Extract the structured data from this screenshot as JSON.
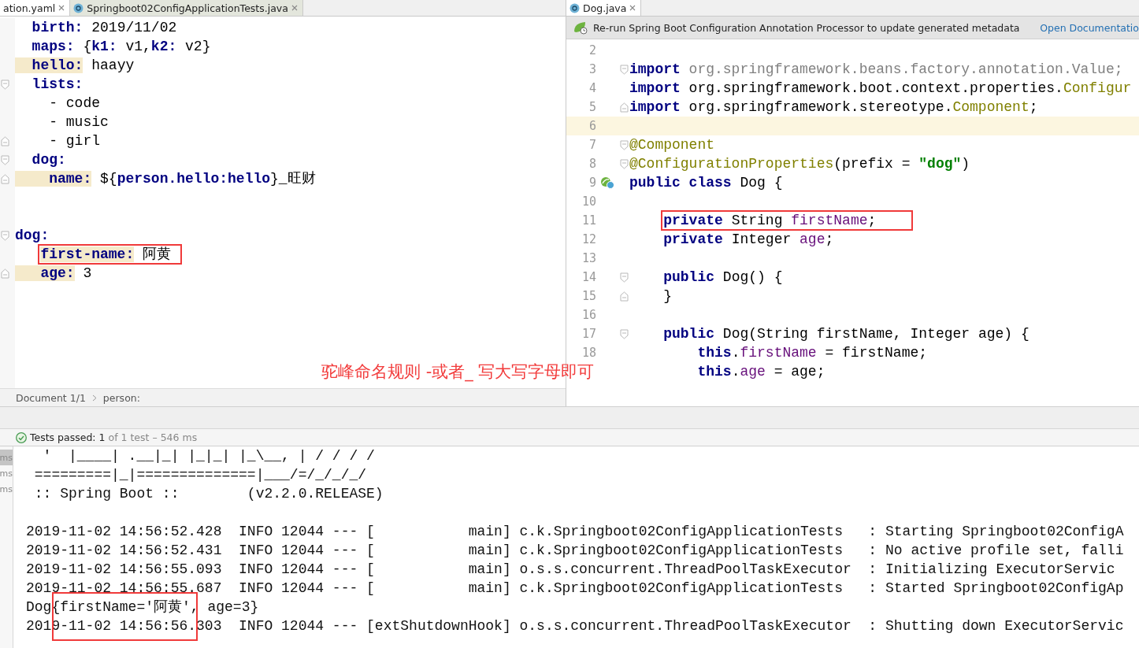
{
  "left_pane": {
    "tabs": [
      {
        "label": "ation.yaml",
        "selected": true,
        "kind": "yaml"
      },
      {
        "label": "Springboot02ConfigApplicationTests.java",
        "selected": false,
        "kind": "java"
      }
    ],
    "lines": [
      {
        "kind": "code",
        "tokens": [
          {
            "kind": "key",
            "text": "  birth:"
          },
          {
            "kind": "plain",
            "text": " 2019/11/02"
          }
        ]
      },
      {
        "kind": "code",
        "tokens": [
          {
            "kind": "key",
            "text": "  maps:"
          },
          {
            "kind": "plain",
            "text": " {"
          },
          {
            "kind": "key",
            "text": "k1:"
          },
          {
            "kind": "plain",
            "text": " v1,"
          },
          {
            "kind": "key",
            "text": "k2:"
          },
          {
            "kind": "plain",
            "text": " v2}"
          }
        ]
      },
      {
        "kind": "code",
        "tokens": [
          {
            "kind": "key_hl",
            "text": "  hello:"
          },
          {
            "kind": "plain",
            "text": " haayy"
          }
        ]
      },
      {
        "kind": "code",
        "fold_start": true,
        "tokens": [
          {
            "kind": "key",
            "text": "  lists:"
          }
        ]
      },
      {
        "kind": "code",
        "tokens": [
          {
            "kind": "plain",
            "text": "    - code"
          }
        ]
      },
      {
        "kind": "code",
        "tokens": [
          {
            "kind": "plain",
            "text": "    - music"
          }
        ]
      },
      {
        "kind": "code",
        "fold_end": true,
        "tokens": [
          {
            "kind": "plain",
            "text": "    - girl"
          }
        ]
      },
      {
        "kind": "code",
        "fold_start": true,
        "tokens": [
          {
            "kind": "key",
            "text": "  dog:"
          }
        ]
      },
      {
        "kind": "code",
        "fold_end": true,
        "tokens": [
          {
            "kind": "key_hl",
            "text": "    name:"
          },
          {
            "kind": "plain",
            "text": " ${"
          },
          {
            "kind": "key",
            "text": "person.hello:hello"
          },
          {
            "kind": "plain",
            "text": "}_旺财"
          }
        ]
      },
      {
        "kind": "blank"
      },
      {
        "kind": "blank"
      },
      {
        "kind": "code",
        "fold_start": true,
        "tokens": [
          {
            "kind": "key",
            "text": "dog:"
          }
        ]
      },
      {
        "kind": "code",
        "boxed": true,
        "tokens": [
          {
            "kind": "key_hl",
            "text": "   first-name:"
          },
          {
            "kind": "plain",
            "text": " 阿黄 "
          }
        ]
      },
      {
        "kind": "code",
        "fold_end": true,
        "tokens": [
          {
            "kind": "key_hl",
            "text": "   age:"
          },
          {
            "kind": "plain",
            "text": " 3"
          }
        ]
      }
    ],
    "breadcrumbs": [
      "Document 1/1",
      "person:"
    ]
  },
  "right_pane": {
    "tabs": [
      {
        "label": "Dog.java",
        "selected": true,
        "kind": "java"
      }
    ],
    "notice": {
      "text": "Re-run Spring Boot Configuration Annotation Processor to update generated metadata",
      "link": "Open Documentatio"
    },
    "lines": [
      {
        "number": "2"
      },
      {
        "number": "3",
        "fold_start": true,
        "tokens": [
          {
            "kind": "keyword",
            "text": "import"
          },
          {
            "kind": "muted",
            "text": " org.springframework.beans.factory.annotation.Value;"
          }
        ]
      },
      {
        "number": "4",
        "tokens": [
          {
            "kind": "keyword",
            "text": "import"
          },
          {
            "kind": "plain",
            "text": " org.springframework.boot.context.properties."
          },
          {
            "kind": "class",
            "text": "Configur"
          }
        ]
      },
      {
        "number": "5",
        "fold_end": true,
        "tokens": [
          {
            "kind": "keyword",
            "text": "import"
          },
          {
            "kind": "plain",
            "text": " org.springframework.stereotype."
          },
          {
            "kind": "class",
            "text": "Component"
          },
          {
            "kind": "plain",
            "text": ";"
          }
        ]
      },
      {
        "number": "6",
        "current": true
      },
      {
        "number": "7",
        "fold_start": true,
        "tokens": [
          {
            "kind": "annotation",
            "text": "@Component"
          }
        ]
      },
      {
        "number": "8",
        "fold_start": true,
        "tokens": [
          {
            "kind": "annotation",
            "text": "@ConfigurationProperties"
          },
          {
            "kind": "plain",
            "text": "(prefix = "
          },
          {
            "kind": "string",
            "text": "\"dog\""
          },
          {
            "kind": "plain",
            "text": ")"
          }
        ]
      },
      {
        "number": "9",
        "bean_marker": true,
        "tokens": [
          {
            "kind": "keyword",
            "text": "public class"
          },
          {
            "kind": "plain",
            "text": " Dog {"
          }
        ]
      },
      {
        "number": "10"
      },
      {
        "number": "11",
        "boxed": true,
        "tokens": [
          {
            "kind": "keyword",
            "text": "    private"
          },
          {
            "kind": "plain",
            "text": " String "
          },
          {
            "kind": "field",
            "text": "firstName"
          },
          {
            "kind": "plain",
            "text": ";    "
          }
        ]
      },
      {
        "number": "12",
        "tokens": [
          {
            "kind": "keyword",
            "text": "    private"
          },
          {
            "kind": "plain",
            "text": " Integer "
          },
          {
            "kind": "field",
            "text": "age"
          },
          {
            "kind": "plain",
            "text": ";"
          }
        ]
      },
      {
        "number": "13"
      },
      {
        "number": "14",
        "fold_start": true,
        "tokens": [
          {
            "kind": "keyword",
            "text": "    public"
          },
          {
            "kind": "plain",
            "text": " Dog() {"
          }
        ]
      },
      {
        "number": "15",
        "fold_end": true,
        "tokens": [
          {
            "kind": "plain",
            "text": "    }"
          }
        ]
      },
      {
        "number": "16"
      },
      {
        "number": "17",
        "fold_start": true,
        "tokens": [
          {
            "kind": "keyword",
            "text": "    public"
          },
          {
            "kind": "plain",
            "text": " Dog(String firstName, Integer age) {"
          }
        ]
      },
      {
        "number": "18",
        "tokens": [
          {
            "kind": "keyword",
            "text": "        this"
          },
          {
            "kind": "plain",
            "text": "."
          },
          {
            "kind": "field",
            "text": "firstName"
          },
          {
            "kind": "plain",
            "text": " = firstName;"
          }
        ]
      },
      {
        "tokens": [
          {
            "kind": "keyword",
            "text": "        this"
          },
          {
            "kind": "plain",
            "text": "."
          },
          {
            "kind": "field",
            "text": "age"
          },
          {
            "kind": "plain",
            "text": " = age;"
          }
        ]
      }
    ]
  },
  "annotation": "驼峰命名规则 -或者_ 写大写字母即可",
  "test_status": {
    "passed": "Tests passed: 1",
    "detail": "of 1 test – 546 ms"
  },
  "test_tree": [
    {
      "text": "ms",
      "selected": true
    },
    {
      "text": "ms",
      "selected": false
    },
    {
      "text": "ms",
      "selected": false
    }
  ],
  "console": {
    "banner": [
      "  '  |____| .__|_| |_|_| |_\\__, | / / / /",
      " =========|_|==============|___/=/_/_/_/",
      " :: Spring Boot ::        (v2.2.0.RELEASE)"
    ],
    "log": [
      "2019-11-02 14:56:52.428  INFO 12044 --- [           main] c.k.Springboot02ConfigApplicationTests   : Starting Springboot02ConfigA",
      "2019-11-02 14:56:52.431  INFO 12044 --- [           main] c.k.Springboot02ConfigApplicationTests   : No active profile set, falli",
      "2019-11-02 14:56:55.093  INFO 12044 --- [           main] o.s.s.concurrent.ThreadPoolTaskExecutor  : Initializing ExecutorServic",
      "2019-11-02 14:56:55.687  INFO 12044 --- [           main] c.k.Springboot02ConfigApplicationTests   : Started Springboot02ConfigAp",
      "Dog{firstName='阿黄', age=3}",
      "2019-11-02 14:56:56.303  INFO 12044 --- [extShutdownHook] o.s.s.concurrent.ThreadPoolTaskExecutor  : Shutting down ExecutorServic"
    ]
  }
}
